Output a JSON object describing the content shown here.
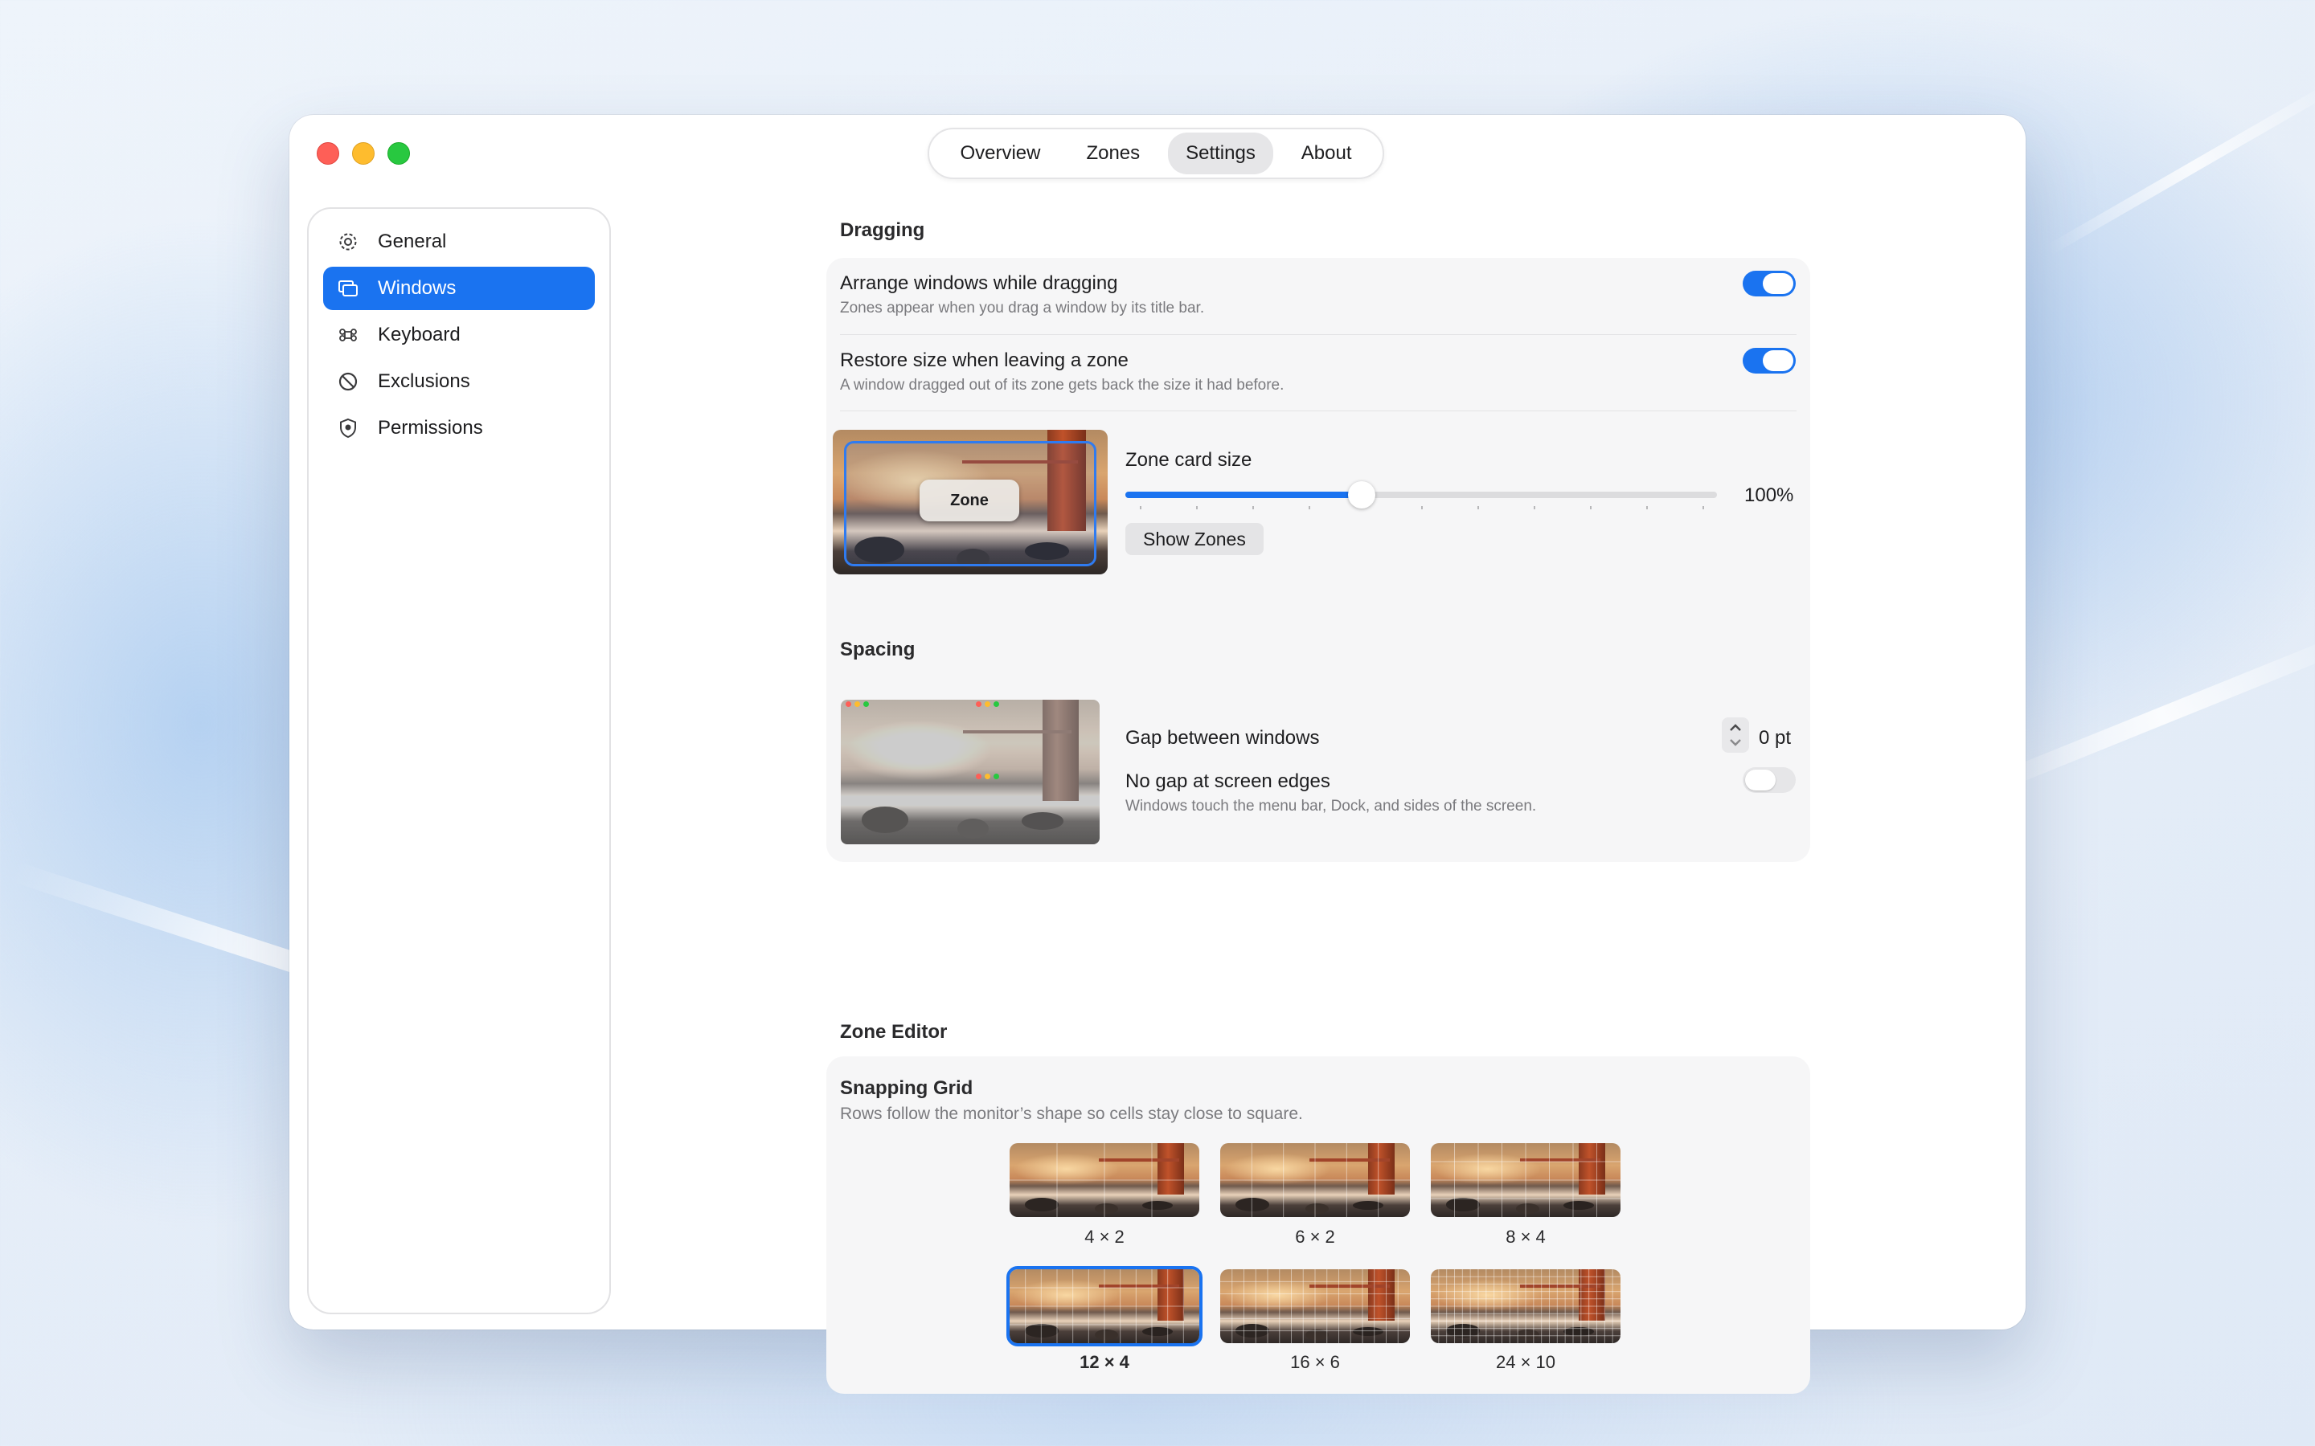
{
  "tabs": [
    {
      "label": "Overview",
      "active": false
    },
    {
      "label": "Zones",
      "active": false
    },
    {
      "label": "Settings",
      "active": true
    },
    {
      "label": "About",
      "active": false
    }
  ],
  "sidebar": {
    "items": [
      {
        "label": "General",
        "icon": "gear-icon",
        "active": false
      },
      {
        "label": "Windows",
        "icon": "windows-icon",
        "active": true
      },
      {
        "label": "Keyboard",
        "icon": "command-icon",
        "active": false
      },
      {
        "label": "Exclusions",
        "icon": "prohibited-icon",
        "active": false
      },
      {
        "label": "Permissions",
        "icon": "shield-icon",
        "active": false
      }
    ]
  },
  "dragging": {
    "title": "Dragging",
    "arrange": {
      "label": "Arrange windows while dragging",
      "description": "Zones appear when you drag a window by its title bar.",
      "enabled": true
    },
    "restore": {
      "label": "Restore size when leaving a zone",
      "description": "A window dragged out of its zone gets back the size it had before.",
      "enabled": true
    },
    "zone_card": {
      "label": "Zone card size",
      "value_text": "100%",
      "value": 0.4,
      "preview_label": "Zone",
      "show_button": "Show Zones"
    }
  },
  "spacing": {
    "title": "Spacing",
    "gap": {
      "label": "Gap between windows",
      "value_text": "0 pt"
    },
    "no_edge_gap": {
      "label": "No gap at screen edges",
      "description": "Windows touch the menu bar, Dock, and sides of the screen.",
      "enabled": false
    }
  },
  "zone_editor": {
    "title": "Zone Editor",
    "grid_title": "Snapping Grid",
    "grid_description": "Rows follow the monitor’s shape so cells stay close to square.",
    "grids": [
      {
        "label": "4 × 2",
        "cols": 4,
        "rows": 2,
        "selected": false
      },
      {
        "label": "6 × 2",
        "cols": 6,
        "rows": 2,
        "selected": false
      },
      {
        "label": "8 × 4",
        "cols": 8,
        "rows": 4,
        "selected": false
      },
      {
        "label": "12 × 4",
        "cols": 12,
        "rows": 4,
        "selected": true
      },
      {
        "label": "16 × 6",
        "cols": 16,
        "rows": 6,
        "selected": false
      },
      {
        "label": "24 × 10",
        "cols": 24,
        "rows": 10,
        "selected": false
      }
    ]
  },
  "colors": {
    "accent": "#1a73f0",
    "close": "#fe5f57",
    "minimize": "#febc2e",
    "maximize": "#28c840"
  }
}
